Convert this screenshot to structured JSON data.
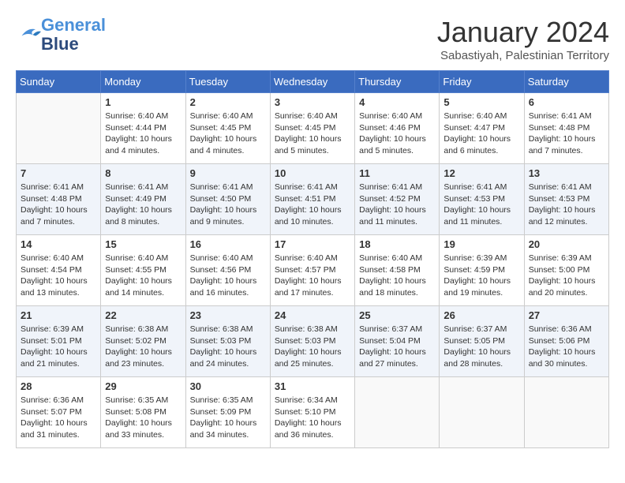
{
  "header": {
    "logo_line1": "General",
    "logo_line2": "Blue",
    "month_title": "January 2024",
    "location": "Sabastiyah, Palestinian Territory"
  },
  "weekdays": [
    "Sunday",
    "Monday",
    "Tuesday",
    "Wednesday",
    "Thursday",
    "Friday",
    "Saturday"
  ],
  "weeks": [
    [
      {
        "day": "",
        "info": ""
      },
      {
        "day": "1",
        "info": "Sunrise: 6:40 AM\nSunset: 4:44 PM\nDaylight: 10 hours\nand 4 minutes."
      },
      {
        "day": "2",
        "info": "Sunrise: 6:40 AM\nSunset: 4:45 PM\nDaylight: 10 hours\nand 4 minutes."
      },
      {
        "day": "3",
        "info": "Sunrise: 6:40 AM\nSunset: 4:45 PM\nDaylight: 10 hours\nand 5 minutes."
      },
      {
        "day": "4",
        "info": "Sunrise: 6:40 AM\nSunset: 4:46 PM\nDaylight: 10 hours\nand 5 minutes."
      },
      {
        "day": "5",
        "info": "Sunrise: 6:40 AM\nSunset: 4:47 PM\nDaylight: 10 hours\nand 6 minutes."
      },
      {
        "day": "6",
        "info": "Sunrise: 6:41 AM\nSunset: 4:48 PM\nDaylight: 10 hours\nand 7 minutes."
      }
    ],
    [
      {
        "day": "7",
        "info": "Sunrise: 6:41 AM\nSunset: 4:48 PM\nDaylight: 10 hours\nand 7 minutes."
      },
      {
        "day": "8",
        "info": "Sunrise: 6:41 AM\nSunset: 4:49 PM\nDaylight: 10 hours\nand 8 minutes."
      },
      {
        "day": "9",
        "info": "Sunrise: 6:41 AM\nSunset: 4:50 PM\nDaylight: 10 hours\nand 9 minutes."
      },
      {
        "day": "10",
        "info": "Sunrise: 6:41 AM\nSunset: 4:51 PM\nDaylight: 10 hours\nand 10 minutes."
      },
      {
        "day": "11",
        "info": "Sunrise: 6:41 AM\nSunset: 4:52 PM\nDaylight: 10 hours\nand 11 minutes."
      },
      {
        "day": "12",
        "info": "Sunrise: 6:41 AM\nSunset: 4:53 PM\nDaylight: 10 hours\nand 11 minutes."
      },
      {
        "day": "13",
        "info": "Sunrise: 6:41 AM\nSunset: 4:53 PM\nDaylight: 10 hours\nand 12 minutes."
      }
    ],
    [
      {
        "day": "14",
        "info": "Sunrise: 6:40 AM\nSunset: 4:54 PM\nDaylight: 10 hours\nand 13 minutes."
      },
      {
        "day": "15",
        "info": "Sunrise: 6:40 AM\nSunset: 4:55 PM\nDaylight: 10 hours\nand 14 minutes."
      },
      {
        "day": "16",
        "info": "Sunrise: 6:40 AM\nSunset: 4:56 PM\nDaylight: 10 hours\nand 16 minutes."
      },
      {
        "day": "17",
        "info": "Sunrise: 6:40 AM\nSunset: 4:57 PM\nDaylight: 10 hours\nand 17 minutes."
      },
      {
        "day": "18",
        "info": "Sunrise: 6:40 AM\nSunset: 4:58 PM\nDaylight: 10 hours\nand 18 minutes."
      },
      {
        "day": "19",
        "info": "Sunrise: 6:39 AM\nSunset: 4:59 PM\nDaylight: 10 hours\nand 19 minutes."
      },
      {
        "day": "20",
        "info": "Sunrise: 6:39 AM\nSunset: 5:00 PM\nDaylight: 10 hours\nand 20 minutes."
      }
    ],
    [
      {
        "day": "21",
        "info": "Sunrise: 6:39 AM\nSunset: 5:01 PM\nDaylight: 10 hours\nand 21 minutes."
      },
      {
        "day": "22",
        "info": "Sunrise: 6:38 AM\nSunset: 5:02 PM\nDaylight: 10 hours\nand 23 minutes."
      },
      {
        "day": "23",
        "info": "Sunrise: 6:38 AM\nSunset: 5:03 PM\nDaylight: 10 hours\nand 24 minutes."
      },
      {
        "day": "24",
        "info": "Sunrise: 6:38 AM\nSunset: 5:03 PM\nDaylight: 10 hours\nand 25 minutes."
      },
      {
        "day": "25",
        "info": "Sunrise: 6:37 AM\nSunset: 5:04 PM\nDaylight: 10 hours\nand 27 minutes."
      },
      {
        "day": "26",
        "info": "Sunrise: 6:37 AM\nSunset: 5:05 PM\nDaylight: 10 hours\nand 28 minutes."
      },
      {
        "day": "27",
        "info": "Sunrise: 6:36 AM\nSunset: 5:06 PM\nDaylight: 10 hours\nand 30 minutes."
      }
    ],
    [
      {
        "day": "28",
        "info": "Sunrise: 6:36 AM\nSunset: 5:07 PM\nDaylight: 10 hours\nand 31 minutes."
      },
      {
        "day": "29",
        "info": "Sunrise: 6:35 AM\nSunset: 5:08 PM\nDaylight: 10 hours\nand 33 minutes."
      },
      {
        "day": "30",
        "info": "Sunrise: 6:35 AM\nSunset: 5:09 PM\nDaylight: 10 hours\nand 34 minutes."
      },
      {
        "day": "31",
        "info": "Sunrise: 6:34 AM\nSunset: 5:10 PM\nDaylight: 10 hours\nand 36 minutes."
      },
      {
        "day": "",
        "info": ""
      },
      {
        "day": "",
        "info": ""
      },
      {
        "day": "",
        "info": ""
      }
    ]
  ]
}
